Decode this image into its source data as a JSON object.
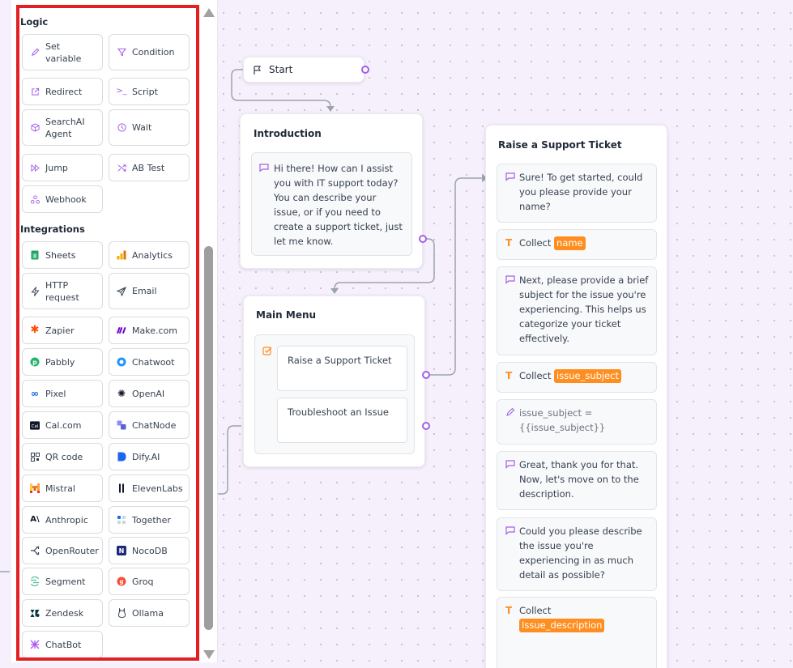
{
  "sidebar": {
    "logic_title": "Logic",
    "integrations_title": "Integrations",
    "logic_blocks": [
      {
        "label": "Set variable",
        "icon": "pencil-icon"
      },
      {
        "label": "Condition",
        "icon": "filter-icon"
      },
      {
        "label": "Redirect",
        "icon": "external-link-icon"
      },
      {
        "label": "Script",
        "icon": "terminal-icon"
      },
      {
        "label": "SearchAI Agent",
        "icon": "cube-icon"
      },
      {
        "label": "Wait",
        "icon": "clock-icon"
      },
      {
        "label": "Jump",
        "icon": "fast-forward-icon"
      },
      {
        "label": "AB Test",
        "icon": "shuffle-icon"
      },
      {
        "label": "Webhook",
        "icon": "webhook-icon"
      }
    ],
    "integration_blocks": [
      {
        "label": "Sheets",
        "icon": "google-sheets-icon"
      },
      {
        "label": "Analytics",
        "icon": "analytics-icon"
      },
      {
        "label": "HTTP request",
        "icon": "lightning-icon"
      },
      {
        "label": "Email",
        "icon": "send-icon"
      },
      {
        "label": "Zapier",
        "icon": "zapier-icon"
      },
      {
        "label": "Make.com",
        "icon": "make-icon"
      },
      {
        "label": "Pabbly",
        "icon": "pabbly-icon"
      },
      {
        "label": "Chatwoot",
        "icon": "chatwoot-icon"
      },
      {
        "label": "Pixel",
        "icon": "meta-icon"
      },
      {
        "label": "OpenAI",
        "icon": "openai-icon"
      },
      {
        "label": "Cal.com",
        "icon": "calcom-icon"
      },
      {
        "label": "ChatNode",
        "icon": "chatnode-icon"
      },
      {
        "label": "QR code",
        "icon": "qr-code-icon"
      },
      {
        "label": "Dify.AI",
        "icon": "dify-icon"
      },
      {
        "label": "Mistral",
        "icon": "mistral-icon"
      },
      {
        "label": "ElevenLabs",
        "icon": "elevenlabs-icon"
      },
      {
        "label": "Anthropic",
        "icon": "anthropic-icon"
      },
      {
        "label": "Together",
        "icon": "together-icon"
      },
      {
        "label": "OpenRouter",
        "icon": "openrouter-icon"
      },
      {
        "label": "NocoDB",
        "icon": "nocodb-icon"
      },
      {
        "label": "Segment",
        "icon": "segment-icon"
      },
      {
        "label": "Groq",
        "icon": "groq-icon"
      },
      {
        "label": "Zendesk",
        "icon": "zendesk-icon"
      },
      {
        "label": "Ollama",
        "icon": "ollama-icon"
      },
      {
        "label": "ChatBot",
        "icon": "chatbot-icon"
      }
    ]
  },
  "flow": {
    "start": {
      "label": "Start"
    },
    "introduction": {
      "title": "Introduction",
      "message": "Hi there! How can I assist you with IT support today? You can describe your issue, or if you need to create a support ticket, just let me know."
    },
    "main_menu": {
      "title": "Main Menu",
      "items": [
        "Raise a Support Ticket",
        "Troubleshoot an Issue"
      ]
    },
    "ticket": {
      "title": "Raise a Support Ticket",
      "msg1": "Sure! To get started, could you please provide your name?",
      "collect1": {
        "label": "Collect",
        "var": "name"
      },
      "msg2": "Next, please provide a brief subject for the issue you're experiencing. This helps us categorize your ticket effectively.",
      "collect2": {
        "label": "Collect",
        "var": "issue_subject"
      },
      "set_var": "issue_subject = {{issue_subject}}",
      "msg3": "Great, thank you for that. Now, let's move on to the description.",
      "msg4": "Could you please describe the issue you're experiencing in as much detail as possible?",
      "collect3": {
        "label": "Collect",
        "var": "Issue_description"
      }
    }
  },
  "colors": {
    "accent": "#a35ee8",
    "variable_tag": "#ff8e20",
    "highlight": "#e31e24"
  }
}
